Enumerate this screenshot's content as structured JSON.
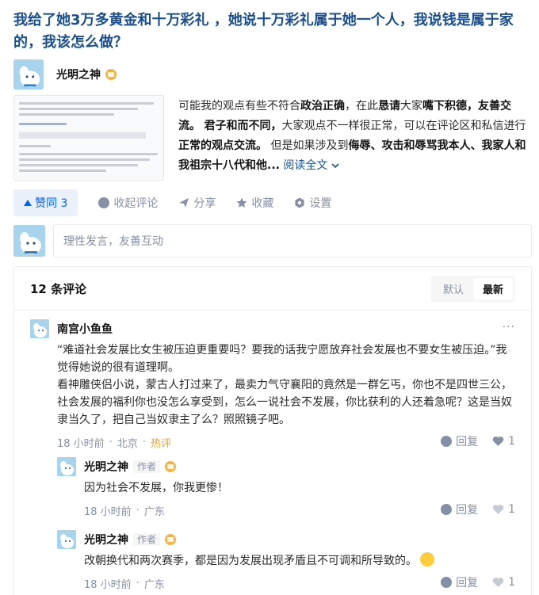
{
  "question": {
    "title": "我给了她3万多黄金和十万彩礼 ，她说十万彩礼属于她一个人，我说钱是属于家的，我该怎么做？"
  },
  "answer": {
    "author": "光明之神",
    "excerpt": {
      "p1": "可能我的观点有些不符合",
      "b1": "政治正确",
      "p2": "，在此",
      "b2": "恳请",
      "p3": "大家",
      "b3": "嘴下积德，友善交流。",
      "p4": " ",
      "b4": "君子和而不同，",
      "p5": "大家观点不一样很正常，可以在评论区和私信进行",
      "b5": "正常的观点交流。",
      "p6": " 但是如果涉及到",
      "b6": "侮辱、攻击和辱骂我本人、我家人和我祖宗十八代和他...",
      "readmore": "阅读全文"
    }
  },
  "actions": {
    "vote_label": "赞同 3",
    "collapse_comments": "收起评论",
    "share": "分享",
    "favorite": "收藏",
    "settings": "设置"
  },
  "composer": {
    "placeholder": "理性发言，友善互动"
  },
  "comments": {
    "count_label": "12 条评论",
    "sort_default": "默认",
    "sort_latest": "最新",
    "items": [
      {
        "name": "南宫小鱼鱼",
        "role": "",
        "body1": "“难道社会发展比女生被压迫更重要吗？要我的话我宁愿放弃社会发展也不要女生被压迫。”我觉得她说的很有道理啊。",
        "body2": "看神雕侠侣小说，蒙古人打过来了，最卖力气守襄阳的竟然是一群乞丐，你也不是四世三公，社会发展的福利你也没怎么享受到，怎么一说社会不发展，你比获利的人还着急呢？这是当奴隶当久了，把自己当奴隶主了么？照照镜子吧。",
        "time": "18 小时前",
        "location": "北京",
        "hot": "热评",
        "reply": "回复",
        "likes": "1"
      },
      {
        "name": "光明之神",
        "role": "作者",
        "body1": "因为社会不发展，你我更惨！",
        "time": "18 小时前",
        "location": "广东",
        "reply": "回复",
        "likes": "1"
      },
      {
        "name": "光明之神",
        "role": "作者",
        "body1": "改朝换代和两次赛季，都是因为发展出现矛盾且不可调和所导致的。",
        "time": "18 小时前",
        "location": "广东",
        "reply": "回复",
        "likes": "1"
      }
    ]
  },
  "colors": {
    "title_blue": "#1a4f8f",
    "accent": "#0066ff",
    "vote_bg": "#eaf1fb",
    "muted": "#8590a6",
    "hot": "#f1a325"
  }
}
